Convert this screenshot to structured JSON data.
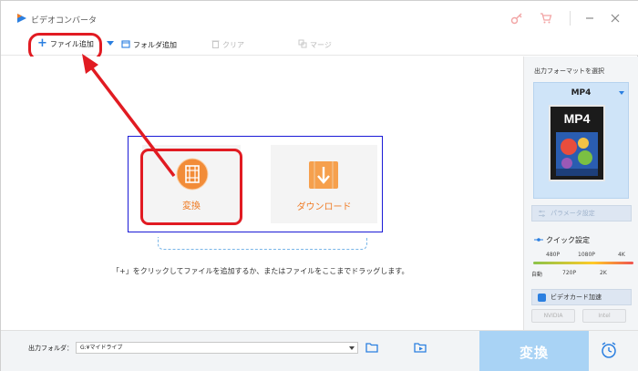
{
  "app": {
    "title": "ビデオコンバータ"
  },
  "toolbar": {
    "add_file": "ファイル追加",
    "add_folder": "フォルダ追加",
    "clear": "クリア",
    "merge": "マージ"
  },
  "main": {
    "convert_label": "変換",
    "download_label": "ダウンロード",
    "hint": "「+」をクリックしてファイルを追加するか、またはファイルをここまでドラッグします。"
  },
  "panel": {
    "title": "出力フォーマットを選択",
    "format": "MP4",
    "format_icon_text": "MP4",
    "param_button": "パラメータ設定",
    "quick_setting": "クイック設定",
    "res_top": [
      "480P",
      "1080P",
      "4K"
    ],
    "res_bottom": [
      "自動",
      "720P",
      "2K"
    ],
    "gpu_accel": "ビデオカード加速",
    "gpu_vendors": [
      "NVIDIA",
      "Intel"
    ]
  },
  "bottom": {
    "output_label": "出力フォルダ：",
    "output_path": "G:¥マイドライブ",
    "convert_button": "変換"
  },
  "colors": {
    "accent_blue": "#2b7fe0",
    "orange": "#ef7c26",
    "annotation_red": "#e11b22",
    "convert_btn_bg": "#a9d3f5"
  }
}
